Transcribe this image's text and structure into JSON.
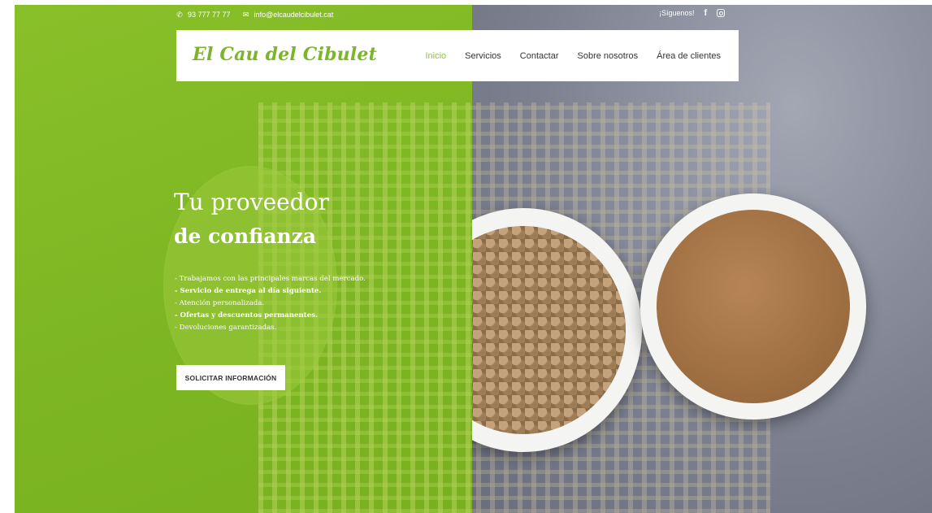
{
  "topbar": {
    "phone": "93 777 77 77",
    "email": "info@elcaudelcibulet.cat",
    "follow_label": "¡Síguenos!"
  },
  "brand": {
    "logo_text": "El Cau del Cibulet"
  },
  "nav": {
    "items": [
      {
        "label": "Inicio",
        "active": true
      },
      {
        "label": "Servicios"
      },
      {
        "label": "Contactar"
      },
      {
        "label": "Sobre nosotros"
      },
      {
        "label": "Área de clientes"
      }
    ]
  },
  "hero": {
    "title_line1": "Tu proveedor",
    "title_line2": "de confianza",
    "bullets": [
      "- Trabajamos con las principales marcas del mercado.",
      "- Servicio de entrega al día siguiente.",
      "- Atención personalizada.",
      "- Ofertas y descuentos permanentes.",
      "- Devoluciones garantizadas."
    ],
    "cta_label": "SOLICITAR INFORMACIÓN"
  },
  "colors": {
    "brand_green": "#7cb52a",
    "nav_active": "#8cc63f",
    "overlay_green": "#84be24"
  },
  "icons": [
    "phone-icon",
    "mail-icon",
    "facebook-icon",
    "instagram-icon"
  ]
}
